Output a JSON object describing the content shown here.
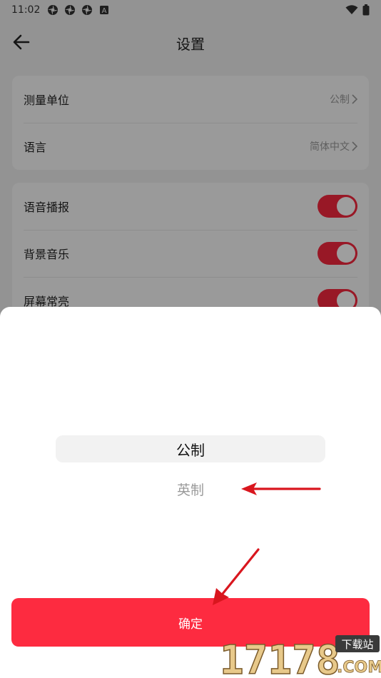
{
  "status_bar": {
    "time": "11:02",
    "icons": [
      "pinwheel-icon",
      "pinwheel-icon",
      "pinwheel-icon",
      "a-badge-icon",
      "wifi-icon",
      "battery-icon"
    ],
    "badge_letter": "A"
  },
  "header": {
    "title": "设置",
    "back_icon": "arrow-left-icon"
  },
  "settings": {
    "card1": [
      {
        "label": "测量单位",
        "value": "公制"
      },
      {
        "label": "语言",
        "value": "简体中文"
      }
    ],
    "card2": [
      {
        "label": "语音播报",
        "on": true
      },
      {
        "label": "背景音乐",
        "on": true
      },
      {
        "label": "屏幕常亮",
        "on": true
      }
    ]
  },
  "picker": {
    "options": [
      "公制",
      "英制"
    ],
    "selected_index": 0,
    "confirm_label": "确定"
  },
  "watermark": {
    "digits": "17178",
    "site": "下载站",
    "domain": ".COM"
  },
  "colors": {
    "accent": "#fd2b40",
    "toggle_on": "#f5283e",
    "annotation_arrow": "#d9161e"
  }
}
